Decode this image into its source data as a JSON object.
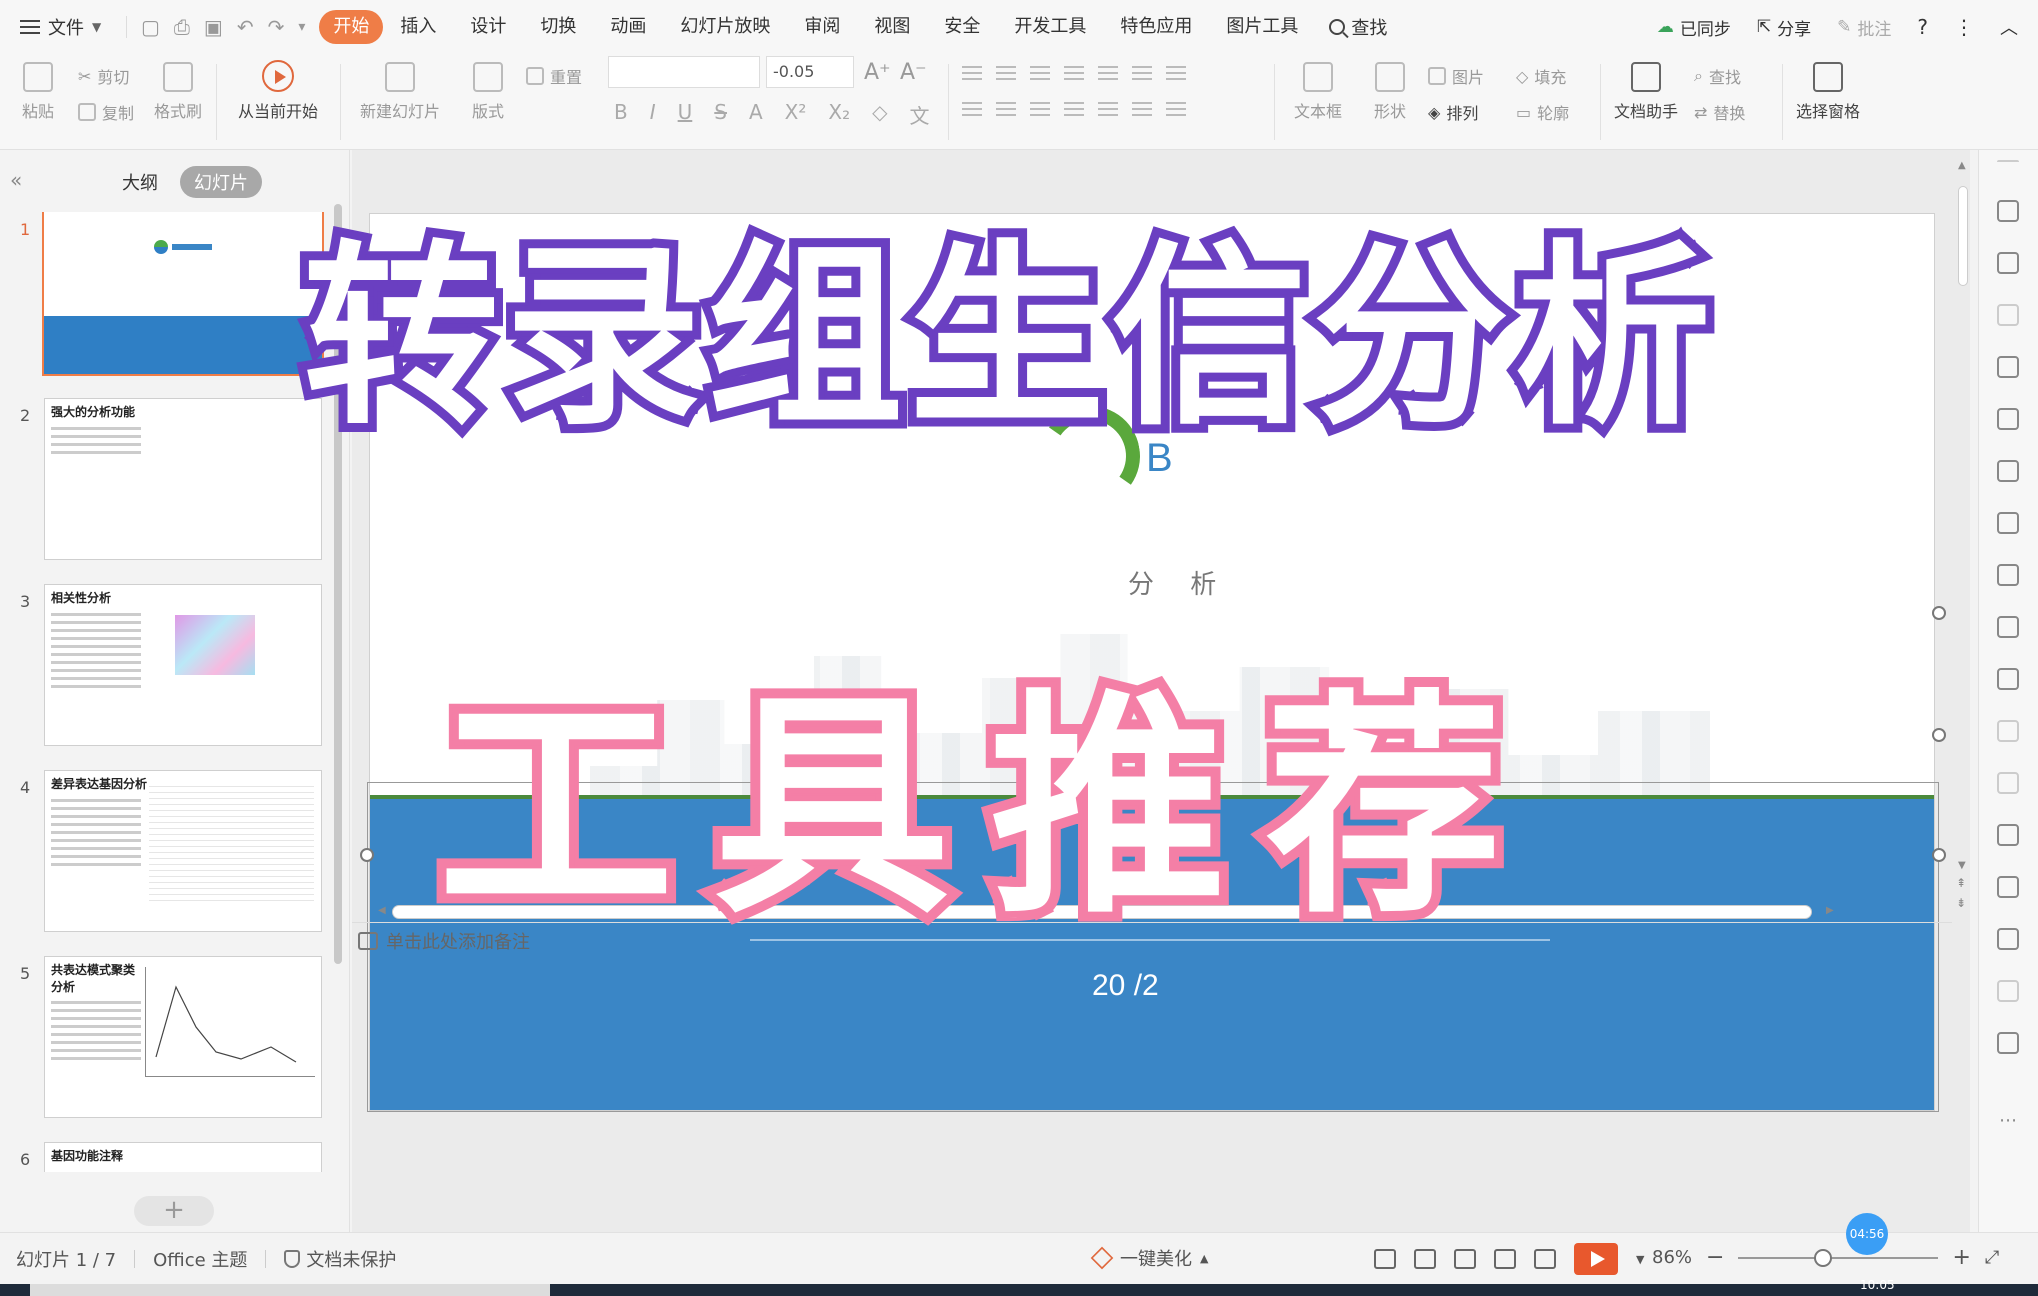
{
  "menubar": {
    "file_label": "文件",
    "menus": [
      {
        "label": "开始",
        "active": true
      },
      {
        "label": "插入"
      },
      {
        "label": "设计"
      },
      {
        "label": "切换"
      },
      {
        "label": "动画"
      },
      {
        "label": "幻灯片放映"
      },
      {
        "label": "审阅"
      },
      {
        "label": "视图"
      },
      {
        "label": "安全"
      },
      {
        "label": "开发工具"
      },
      {
        "label": "特色应用"
      },
      {
        "label": "图片工具"
      }
    ],
    "search_label": "查找",
    "sync_label": "已同步",
    "share_label": "分享",
    "comment_label": "批注"
  },
  "ribbon": {
    "paste": "粘贴",
    "cut": "剪切",
    "copy": "复制",
    "format_painter": "格式刷",
    "play_from_current": "从当前开始",
    "new_slide": "新建幻灯片",
    "layout": "版式",
    "reset": "重置",
    "font_size": "-0.05",
    "text_box": "文本框",
    "shape": "形状",
    "picture": "图片",
    "arrange": "排列",
    "fill": "填充",
    "outline": "轮廓",
    "doc_assistant": "文档助手",
    "find": "查找",
    "replace": "替换",
    "selection_pane": "选择窗格"
  },
  "leftpanel": {
    "tab_outline": "大纲",
    "tab_slides": "幻灯片",
    "thumbs": [
      {
        "num": "1",
        "title": ""
      },
      {
        "num": "2",
        "title": "强大的分析功能"
      },
      {
        "num": "3",
        "title": "相关性分析"
      },
      {
        "num": "4",
        "title": "差异表达基因分析"
      },
      {
        "num": "5",
        "title": "共表达模式聚类分析"
      },
      {
        "num": "6",
        "title": "基因功能注释"
      }
    ]
  },
  "slide": {
    "logo_letter": "B",
    "subtitle_fragment": "分 析",
    "date_fragment": "20   /2"
  },
  "overlay": {
    "title": "转录组生信分析",
    "subtitle": "工具推荐"
  },
  "notes_placeholder": "单击此处添加备注",
  "status": {
    "slide_counter": "幻灯片 1 / 7",
    "theme": "Office 主题",
    "protection": "文档未保护",
    "beautify": "一键美化",
    "zoom": "86%",
    "timer": "04:56",
    "clock": "10:05"
  },
  "colors": {
    "accent": "#ef7d47",
    "slide_blue": "#3a86c6",
    "title_stroke": "#6a3fc1",
    "subtitle_stroke": "#f47fa6"
  }
}
